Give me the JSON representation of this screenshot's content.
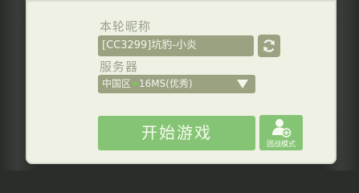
{
  "form": {
    "nickname_label": "本轮昵称",
    "nickname_value": "[CC3299]坑豹-小炎",
    "server_label": "服务器",
    "server_region": "中国区",
    "server_ping": "16MS(优秀)",
    "start_button": "开始游戏",
    "team_button": "团战模式"
  },
  "colors": {
    "panel_bg": "#eef1e4",
    "field_bg": "#9ba282",
    "start_green": "#86c475",
    "ping_good": "#7ec25a"
  },
  "icons": {
    "refresh": "refresh-icon",
    "dropdown": "triangle-down-icon",
    "team": "user-add-icon"
  }
}
